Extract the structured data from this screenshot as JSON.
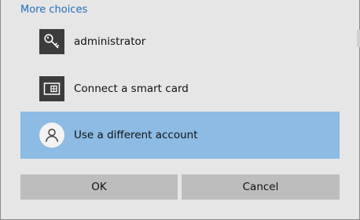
{
  "dialog": {
    "more_choices_link": "More choices",
    "options": [
      {
        "label": "administrator",
        "icon": "key-icon",
        "selected": false
      },
      {
        "label": "Connect a smart card",
        "icon": "smart-card-icon",
        "selected": false
      },
      {
        "label": "Use a different account",
        "icon": "user-icon",
        "selected": true
      }
    ],
    "buttons": {
      "ok_label": "OK",
      "cancel_label": "Cancel"
    }
  },
  "colors": {
    "background": "#e6e6e6",
    "link": "#1f6fbf",
    "selected_option": "#8dbbe3",
    "button": "#bdbdbd",
    "icon_tile": "#3c3c3c"
  }
}
